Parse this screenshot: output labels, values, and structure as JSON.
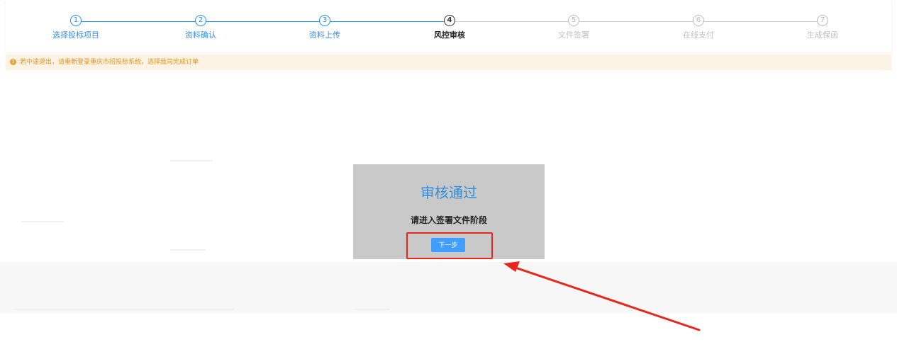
{
  "steps": [
    {
      "num": "1",
      "label": "选择投标项目",
      "state": "done"
    },
    {
      "num": "2",
      "label": "资料确认",
      "state": "done"
    },
    {
      "num": "3",
      "label": "资料上传",
      "state": "done"
    },
    {
      "num": "4",
      "label": "风控审核",
      "state": "current"
    },
    {
      "num": "5",
      "label": "文件签署",
      "state": "pending"
    },
    {
      "num": "6",
      "label": "在线支付",
      "state": "pending"
    },
    {
      "num": "7",
      "label": "生成保函",
      "state": "pending"
    }
  ],
  "notice": {
    "icon": "warning-icon",
    "text": "若中途退出，请重新登录重庆市招投标系统，选择我司完成订单"
  },
  "modal": {
    "title": "审核通过",
    "subtitle": "请进入签署文件阶段",
    "next_label": "下一步"
  },
  "colors": {
    "primary": "#1890ff",
    "notice_bg": "#fdf3e4",
    "notice_text": "#e69320",
    "annotation_red": "#e8261c",
    "modal_bg": "#c9c9c9"
  }
}
